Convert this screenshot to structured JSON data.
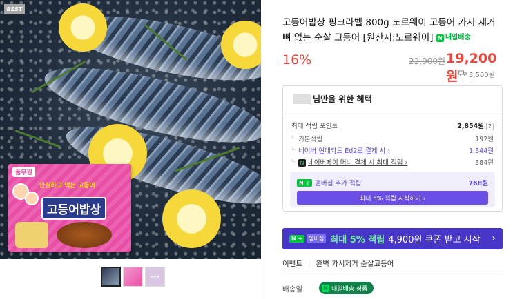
{
  "gallery": {
    "badge": "BEST",
    "package_brand": "풀무원",
    "package_subtitle": "안심하고 먹는 고등어",
    "package_title": "고등어밥상",
    "more_icon": "ellipsis-icon"
  },
  "product": {
    "title": "고등어밥상 핑크라벨 800g 노르웨이 고등어 가시 제거 뼈 없는 순살 고등어 [원산지:노르웨이]",
    "delivery_badge": "내일배송",
    "discount": "16%",
    "original_price": "22,900원",
    "sale_price": "19,200원",
    "shipping_fee": "3,500원",
    "shipping_icon": "truck-icon"
  },
  "benefit": {
    "header": "님만을 위한 혜택",
    "max_points_label": "최대 적립 포인트",
    "max_points_value": "2,854원",
    "help_mark": "?",
    "basic_label": "기본적립",
    "basic_value": "192원",
    "card_label": "네이버 현대카드 Ed2로 결제 시 ›",
    "card_value": "1,344원",
    "npay_label": "네이버페이 머니 결제 시 최대 적립 ›",
    "npay_value": "384원",
    "member_label": "멤버십 추가 적립",
    "member_value": "768원",
    "member_badge": "N +",
    "member_button": "최대 5% 적립 시작하기 ›"
  },
  "banner": {
    "badge": "N +",
    "tag": "멤버십",
    "accent": "최대 5% 적립",
    "text": "4,900원 쿠폰 받고 시작",
    "chevron": "›"
  },
  "event": {
    "label": "이벤트",
    "text": "완벽 가시제거 순살고등어"
  },
  "delivery": {
    "label": "배송일",
    "badge": "내일배송 상품"
  }
}
